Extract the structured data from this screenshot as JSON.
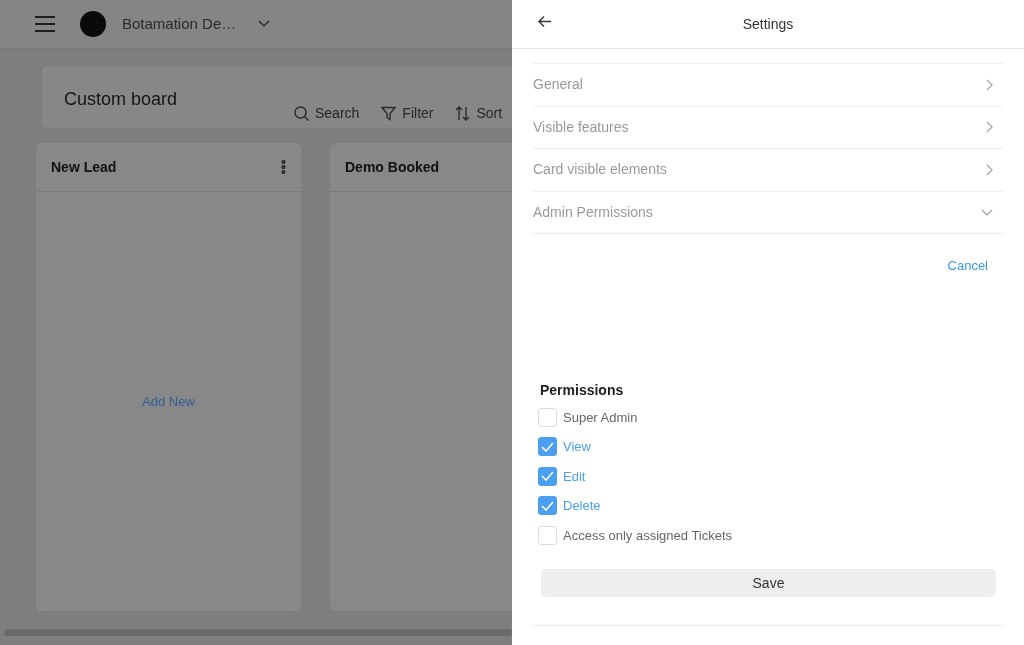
{
  "topbar": {
    "workspace": "Botamation De…"
  },
  "board": {
    "title": "Custom board",
    "tools": [
      {
        "kind": "search",
        "label": "Search"
      },
      {
        "kind": "filter",
        "label": "Filter"
      },
      {
        "kind": "sort",
        "label": "Sort"
      }
    ],
    "columns": [
      {
        "title": "New Lead",
        "menu": true,
        "add_label": "Add New"
      },
      {
        "title": "Demo Booked",
        "menu": false
      }
    ]
  },
  "settings": {
    "title": "Settings",
    "sections": [
      {
        "label": "General",
        "expanded": false
      },
      {
        "label": "Visible features",
        "expanded": false
      },
      {
        "label": "Card visible elements",
        "expanded": false
      },
      {
        "label": "Admin Permissions",
        "expanded": true
      }
    ],
    "cancel": "Cancel",
    "permissions_title": "Permissions",
    "permissions": [
      {
        "label": "Super Admin",
        "checked": false
      },
      {
        "label": "View",
        "checked": true
      },
      {
        "label": "Edit",
        "checked": true
      },
      {
        "label": "Delete",
        "checked": true
      },
      {
        "label": "Access only assigned Tickets",
        "checked": false
      }
    ],
    "save": "Save"
  }
}
